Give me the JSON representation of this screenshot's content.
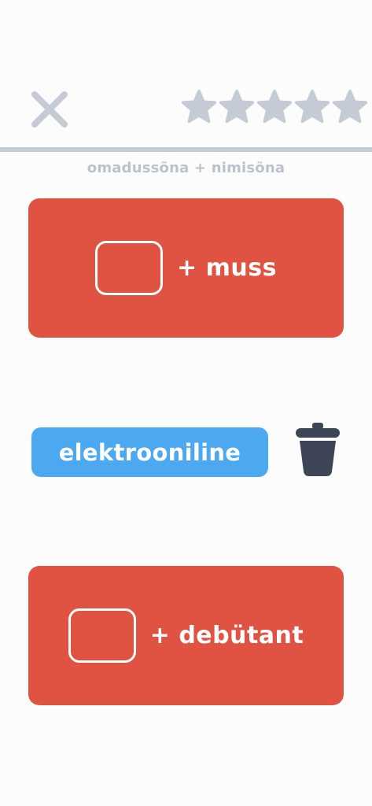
{
  "header": {
    "close_icon": "close-icon",
    "rating": {
      "total_stars": 5,
      "filled_stars": 0,
      "star_color": "#C5CBD5"
    }
  },
  "subtitle": "omadussõna + nimisõna",
  "cards": [
    {
      "label": "+ muss"
    },
    {
      "label": "+ debütant"
    }
  ],
  "word_chip": {
    "label": "elektrooniline"
  },
  "trash_icon": "trash-icon",
  "colors": {
    "card": "#E05342",
    "chip": "#4CA8F0",
    "trash": "#3D4556",
    "muted": "#C5CBD5"
  }
}
